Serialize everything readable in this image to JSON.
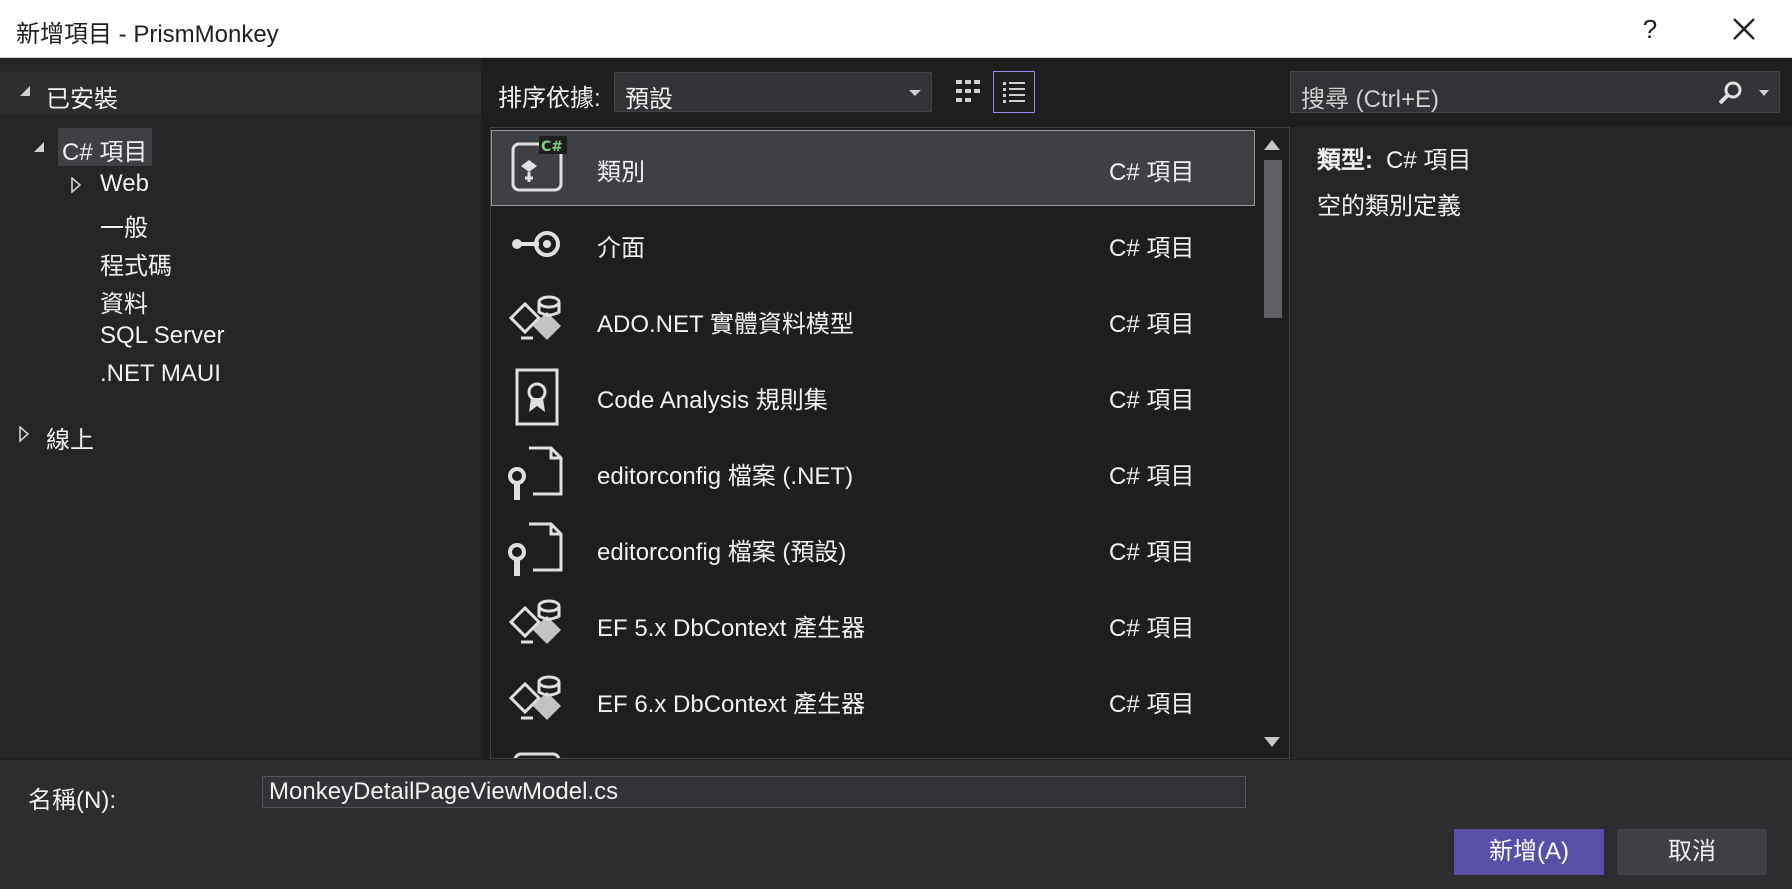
{
  "window": {
    "title": "新增項目 - PrismMonkey",
    "help_label": "?",
    "close_icon": "close-icon"
  },
  "left_panel": {
    "installed_label": "已安裝",
    "tree": {
      "root_label": "C# 項目",
      "children": [
        "Web",
        "一般",
        "程式碼",
        "資料",
        "SQL Server",
        ".NET MAUI"
      ]
    },
    "online_label": "線上"
  },
  "toolbar": {
    "sort_label": "排序依據:",
    "sort_value": "預設",
    "view_modes": [
      "grid-view-icon",
      "list-view-icon"
    ],
    "active_view": "list",
    "search_placeholder": "搜尋 (Ctrl+E)"
  },
  "templates": [
    {
      "name": "類別",
      "type": "C# 項目",
      "icon": "class-icon",
      "selected": true
    },
    {
      "name": "介面",
      "type": "C# 項目",
      "icon": "interface-icon"
    },
    {
      "name": "ADO.NET 實體資料模型",
      "type": "C# 項目",
      "icon": "entity-model-icon"
    },
    {
      "name": "Code Analysis 規則集",
      "type": "C# 項目",
      "icon": "ruleset-icon"
    },
    {
      "name": "editorconfig 檔案 (.NET)",
      "type": "C# 項目",
      "icon": "editorconfig-icon"
    },
    {
      "name": "editorconfig 檔案 (預設)",
      "type": "C# 項目",
      "icon": "editorconfig-icon"
    },
    {
      "name": "EF 5.x DbContext 產生器",
      "type": "C# 項目",
      "icon": "dbcontext-generator-icon"
    },
    {
      "name": "EF 6.x DbContext 產生器",
      "type": "C# 項目",
      "icon": "dbcontext-generator-icon"
    }
  ],
  "details": {
    "type_label": "類型:",
    "type_value": "C# 項目",
    "description": "空的類別定義"
  },
  "footer": {
    "name_label": "名稱(N):",
    "name_value": "MonkeyDetailPageViewModel.cs",
    "add_button": "新增(A)",
    "cancel_button": "取消"
  },
  "colors": {
    "accent": "#5a4fa8",
    "focus_border": "#8c87f5",
    "background": "#1e1e1e",
    "panel": "#252526",
    "selected_row": "#3f3f46"
  }
}
